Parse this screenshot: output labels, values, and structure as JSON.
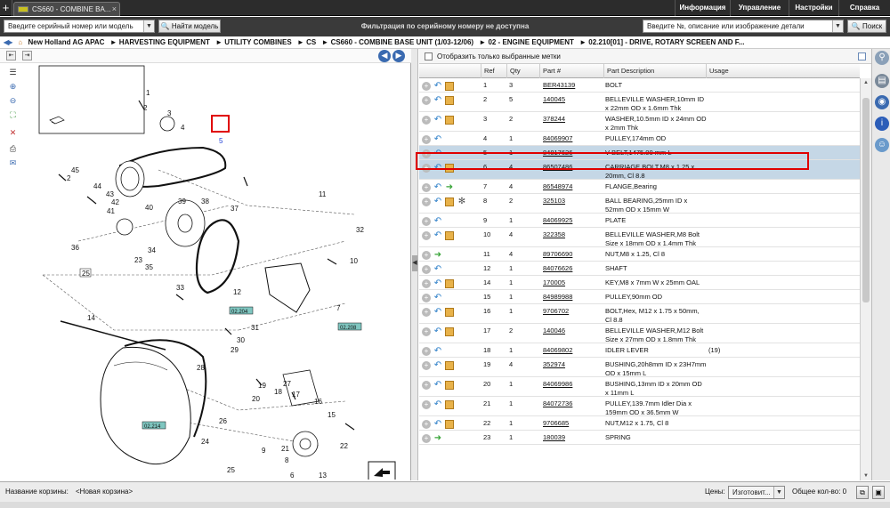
{
  "tabs": {
    "plus": "+",
    "active_tab": "CS660 - COMBINE BA...",
    "close": "×"
  },
  "menu": [
    "Информация",
    "Управление",
    "Настройки",
    "Справка"
  ],
  "search": {
    "model_select": "Введите серийный номер или модель",
    "find_model": "Найти модель",
    "filter_title": "Фильтрация по серийному номеру не доступна",
    "part_select": "Введите №, описание или изображение детали",
    "search_btn": "Поиск"
  },
  "breadcrumb": [
    "New Holland AG APAC",
    "► HARVESTING EQUIPMENT",
    "► UTILITY COMBINES",
    "► CS",
    "► CS660 - COMBINE BASE UNIT (1/03-12/06)",
    "► 02 - ENGINE EQUIPMENT",
    "► 02.210[01] - DRIVE, ROTARY SCREEN AND F..."
  ],
  "diagram": {
    "callouts": [
      "1",
      "2",
      "3",
      "4",
      "5",
      "45",
      "2",
      "44",
      "43",
      "42",
      "41",
      "40",
      "39",
      "38",
      "37",
      "36",
      "23",
      "34",
      "35",
      "25",
      "33",
      "32",
      "10",
      "11",
      "7",
      "14",
      "12",
      "31",
      "30",
      "29",
      "28",
      "26",
      "27",
      "24",
      "25",
      "19",
      "18",
      "17",
      "16",
      "15",
      "20",
      "21",
      "22",
      "9",
      "8",
      "6",
      "13"
    ],
    "tags": [
      "02.204",
      "02.208",
      "02.214"
    ],
    "highlight_callout": "5"
  },
  "parts": {
    "show_selected_label": "Отобразить только выбранные метки",
    "columns": {
      "ref": "Ref",
      "qty": "Qty",
      "part": "Part #",
      "desc": "Part Description",
      "usage": "Usage"
    },
    "rows": [
      {
        "ref": "1",
        "qty": "3",
        "part": "BER43139",
        "desc": "BOLT",
        "usage": "",
        "icons": [
          "plus",
          "undo",
          "box"
        ]
      },
      {
        "ref": "2",
        "qty": "5",
        "part": "140045",
        "desc": "BELLEVILLE WASHER,10mm ID x 22mm OD x 1.6mm Thk",
        "usage": "",
        "icons": [
          "plus",
          "undo",
          "box"
        ]
      },
      {
        "ref": "3",
        "qty": "2",
        "part": "378244",
        "desc": "WASHER,10.5mm ID x 24mm OD x 2mm Thk",
        "usage": "",
        "icons": [
          "plus",
          "undo",
          "box"
        ]
      },
      {
        "ref": "4",
        "qty": "1",
        "part": "84069907",
        "desc": "PULLEY,174mm OD",
        "usage": "",
        "icons": [
          "plus",
          "undo"
        ]
      },
      {
        "ref": "5",
        "qty": "1",
        "part": "84817626",
        "desc": "V-BELT,1475.00 mm L",
        "usage": "",
        "icons": [
          "plus",
          "undo"
        ],
        "highlight": true
      },
      {
        "ref": "6",
        "qty": "4",
        "part": "86507486",
        "desc": "CARRIAGE BOLT,M8 x 1.25 x 20mm, Cl 8.8",
        "usage": "",
        "icons": [
          "plus",
          "undo",
          "box"
        ],
        "highlight": true
      },
      {
        "ref": "7",
        "qty": "4",
        "part": "86548974",
        "desc": "FLANGE,Bearing",
        "usage": "",
        "icons": [
          "plus",
          "undo",
          "arrow"
        ]
      },
      {
        "ref": "8",
        "qty": "2",
        "part": "325103",
        "desc": "BALL BEARING,25mm ID x 52mm OD x 15mm W",
        "usage": "",
        "icons": [
          "plus",
          "undo",
          "box",
          "gear"
        ]
      },
      {
        "ref": "9",
        "qty": "1",
        "part": "84069925",
        "desc": "PLATE",
        "usage": "",
        "icons": [
          "plus",
          "undo"
        ]
      },
      {
        "ref": "10",
        "qty": "4",
        "part": "322358",
        "desc": "BELLEVILLE WASHER,M8 Bolt Size x 18mm OD x 1.4mm Thk",
        "usage": "",
        "icons": [
          "plus",
          "undo",
          "box"
        ]
      },
      {
        "ref": "11",
        "qty": "4",
        "part": "89706690",
        "desc": "NUT,M8 x 1.25, Cl 8",
        "usage": "",
        "icons": [
          "plus",
          "arrow"
        ]
      },
      {
        "ref": "12",
        "qty": "1",
        "part": "84076626",
        "desc": "SHAFT",
        "usage": "",
        "icons": [
          "plus",
          "undo"
        ]
      },
      {
        "ref": "14",
        "qty": "1",
        "part": "170005",
        "desc": "KEY,M8 x 7mm W x 25mm OAL",
        "usage": "",
        "icons": [
          "plus",
          "undo",
          "box"
        ]
      },
      {
        "ref": "15",
        "qty": "1",
        "part": "84989988",
        "desc": "PULLEY,90mm OD",
        "usage": "",
        "icons": [
          "plus",
          "undo"
        ]
      },
      {
        "ref": "16",
        "qty": "1",
        "part": "9706702",
        "desc": "BOLT,Hex, M12 x 1.75 x 50mm, Cl 8.8",
        "usage": "",
        "icons": [
          "plus",
          "undo",
          "box"
        ]
      },
      {
        "ref": "17",
        "qty": "2",
        "part": "140046",
        "desc": "BELLEVILLE WASHER,M12 Bolt Size x 27mm OD x 1.8mm Thk",
        "usage": "",
        "icons": [
          "plus",
          "undo",
          "box"
        ]
      },
      {
        "ref": "18",
        "qty": "1",
        "part": "84069802",
        "desc": "IDLER LEVER",
        "usage": "(19)",
        "icons": [
          "plus",
          "undo"
        ]
      },
      {
        "ref": "19",
        "qty": "4",
        "part": "352974",
        "desc": "BUSHING,20h8mm ID x 23H7mm OD x 15mm L",
        "usage": "",
        "icons": [
          "plus",
          "undo",
          "box"
        ]
      },
      {
        "ref": "20",
        "qty": "1",
        "part": "84069986",
        "desc": "BUSHING,13mm ID x 20mm OD x 11mm L",
        "usage": "",
        "icons": [
          "plus",
          "undo",
          "box"
        ]
      },
      {
        "ref": "21",
        "qty": "1",
        "part": "84072736",
        "desc": "PULLEY,139.7mm Idler Dia x 159mm OD x 36.5mm W",
        "usage": "",
        "icons": [
          "plus",
          "undo",
          "box"
        ]
      },
      {
        "ref": "22",
        "qty": "1",
        "part": "9706685",
        "desc": "NUT,M12 x 1.75, Cl 8",
        "usage": "",
        "icons": [
          "plus",
          "undo",
          "box"
        ]
      },
      {
        "ref": "23",
        "qty": "1",
        "part": "180039",
        "desc": "SPRING",
        "usage": "",
        "icons": [
          "plus",
          "arrow"
        ]
      }
    ]
  },
  "status": {
    "basket_label": "Название корзины:",
    "basket_name": "<Новая корзина>",
    "prices_label": "Цены:",
    "prices_value": "Изготовит...",
    "total_label": "Общее кол-во: 0"
  }
}
